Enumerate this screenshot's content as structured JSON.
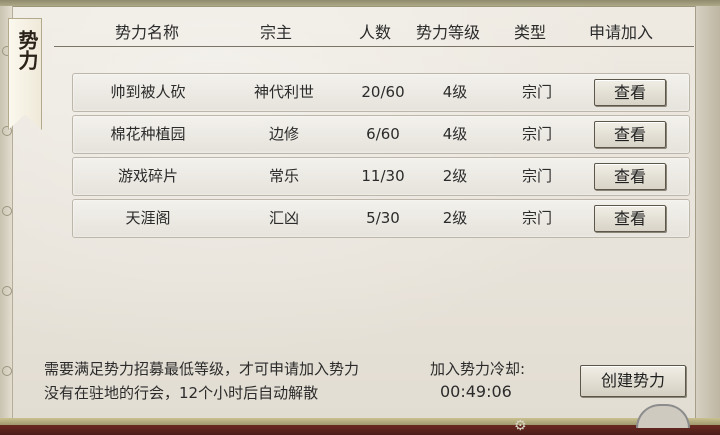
{
  "panel": {
    "title": "势力"
  },
  "table": {
    "headers": [
      "势力名称",
      "宗主",
      "人数",
      "势力等级",
      "类型",
      "申请加入"
    ],
    "rows": [
      {
        "name": "帅到被人砍",
        "leader": "神代利世",
        "members": "20/60",
        "level": "4级",
        "type": "宗门",
        "action": "查看"
      },
      {
        "name": "棉花种植园",
        "leader": "边修",
        "members": "6/60",
        "level": "4级",
        "type": "宗门",
        "action": "查看"
      },
      {
        "name": "游戏碎片",
        "leader": "常乐",
        "members": "11/30",
        "level": "2级",
        "type": "宗门",
        "action": "查看"
      },
      {
        "name": "天涯阁",
        "leader": "汇凶",
        "members": "5/30",
        "level": "2级",
        "type": "宗门",
        "action": "查看"
      }
    ]
  },
  "footer": {
    "note_line1": "需要满足势力招募最低等级，才可申请加入势力",
    "note_line2": "没有在驻地的行会，12个小时后自动解散",
    "cooldown_label": "加入势力冷却:",
    "cooldown_value": "00:49:06",
    "create_label": "创建势力"
  }
}
